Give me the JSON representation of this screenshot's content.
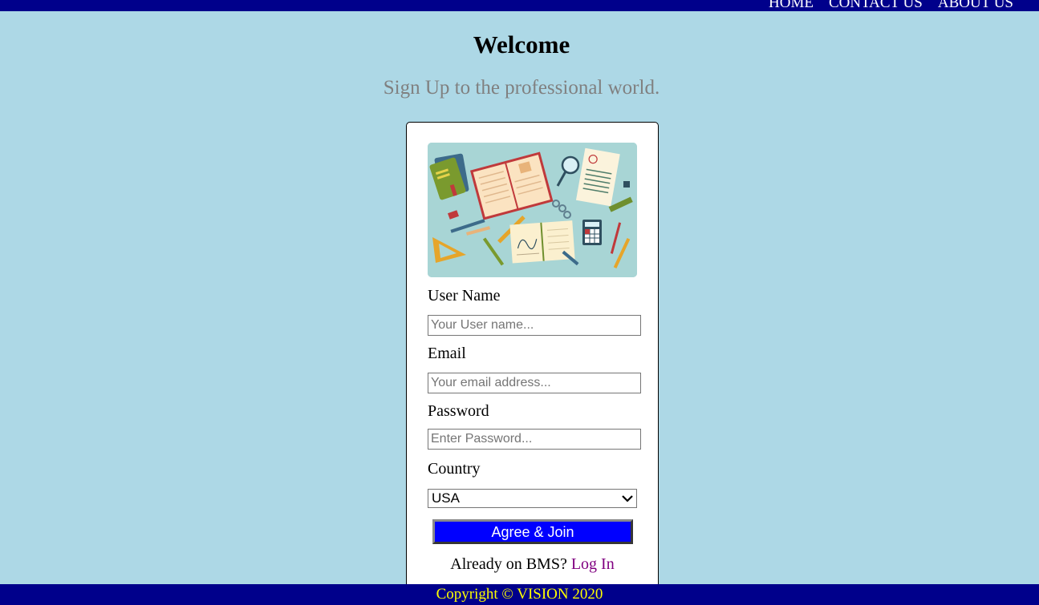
{
  "nav": {
    "items": [
      {
        "label": "HOME"
      },
      {
        "label": "CONTACT US"
      },
      {
        "label": "ABOUT US"
      }
    ]
  },
  "header": {
    "title": "Welcome",
    "tagline": "Sign Up to the professional world."
  },
  "form": {
    "hero_image": "education-desk-illustration",
    "username": {
      "label": "User Name",
      "placeholder": "Your User name...",
      "value": ""
    },
    "email": {
      "label": "Email",
      "placeholder": "Your email address...",
      "value": ""
    },
    "password": {
      "label": "Password",
      "placeholder": "Enter Password...",
      "value": ""
    },
    "country": {
      "label": "Country",
      "selected": "USA"
    },
    "submit_label": "Agree & Join",
    "already_text": "Already on BMS?",
    "login_link": "Log In"
  },
  "footer": {
    "copyright": "Copyright © VISION 2020"
  },
  "colors": {
    "page_bg": "#add8e6",
    "bar_bg": "#00008b",
    "button_bg": "#0000ff",
    "footer_text": "#ffff00",
    "link": "#800080",
    "tagline": "#808080"
  }
}
